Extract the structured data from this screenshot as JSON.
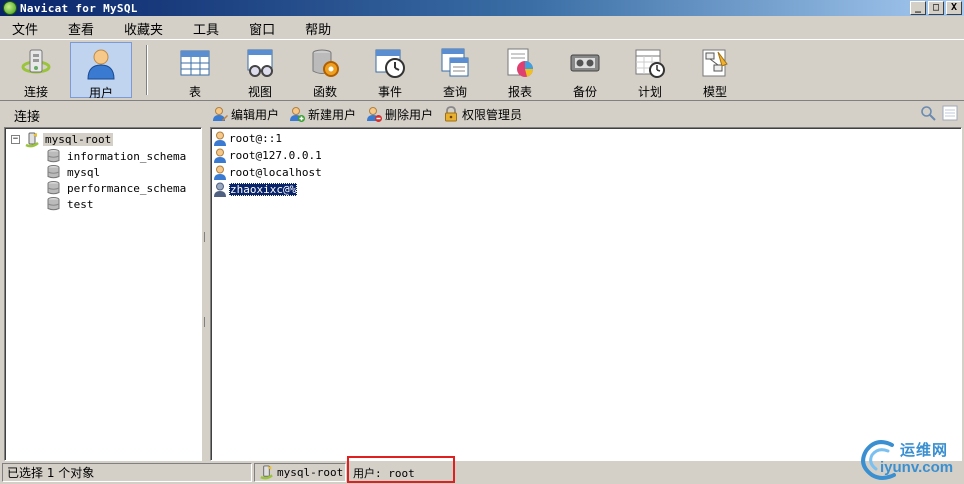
{
  "window": {
    "title": "Navicat for MySQL",
    "minimize": "_",
    "maximize": "□",
    "close": "X"
  },
  "menu": [
    "文件",
    "查看",
    "收藏夹",
    "工具",
    "窗口",
    "帮助"
  ],
  "toolbar": {
    "connect": "连接",
    "user": "用户",
    "table": "表",
    "view": "视图",
    "function": "函数",
    "event": "事件",
    "query": "查询",
    "report": "报表",
    "backup": "备份",
    "schedule": "计划",
    "model": "模型"
  },
  "sidebar": {
    "header": "连接",
    "connection": {
      "expander": "−",
      "name": "mysql-root",
      "databases": [
        "information_schema",
        "mysql",
        "performance_schema",
        "test"
      ]
    }
  },
  "object_toolbar": {
    "edit_user": "编辑用户",
    "new_user": "新建用户",
    "delete_user": "删除用户",
    "privilege_manager": "权限管理员"
  },
  "users": [
    {
      "name": "root@::1",
      "selected": false
    },
    {
      "name": "root@127.0.0.1",
      "selected": false
    },
    {
      "name": "root@localhost",
      "selected": false
    },
    {
      "name": "zhaoxixc@%",
      "selected": true
    }
  ],
  "status": {
    "selection": "已选择 1 个对象",
    "connection": "mysql-root",
    "user": "用户: root"
  },
  "watermark": {
    "cn": "运维网",
    "en": "iyunv.com"
  },
  "colors": {
    "accent": "#0a246a",
    "highlight_box": "#e02020",
    "watermark": "#3a8fd0"
  }
}
